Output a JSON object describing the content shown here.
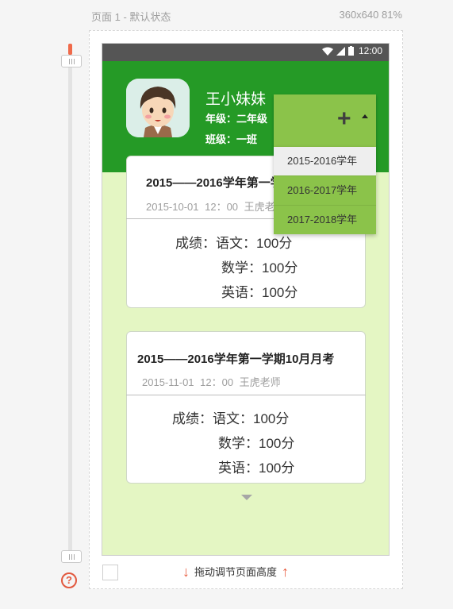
{
  "canvas": {
    "page_title": "页面 1 - 默认状态",
    "device_size": "360x640 81%",
    "resize_hint": "拖动调节页面高度"
  },
  "status_bar": {
    "time": "12:00"
  },
  "profile": {
    "name": "王小妹妹",
    "grade": "年级：二年级",
    "class": "班级：一班"
  },
  "dropdown": {
    "items": [
      {
        "label": "2015-2016学年",
        "selected": true
      },
      {
        "label": "2016-2017学年",
        "selected": false
      },
      {
        "label": "2017-2018学年",
        "selected": false
      }
    ]
  },
  "exams": [
    {
      "title": "2015——2016学年第一学期10月月考",
      "meta": "2015-10-01 12：00 王虎老师",
      "scores": [
        "成绩：语文：100分",
        "数学：100分",
        "英语：100分"
      ]
    },
    {
      "title": "2015——2016学年第一学期10月月考",
      "meta": "2015-11-01 12：00 王虎老师",
      "scores": [
        "成绩：语文：100分",
        "数学：100分",
        "英语：100分"
      ]
    }
  ],
  "colors": {
    "header_green": "#259a26",
    "content_bg": "#e4f6c3",
    "dropdown_green": "#8bc34a",
    "accent_red": "#e85a3c"
  }
}
